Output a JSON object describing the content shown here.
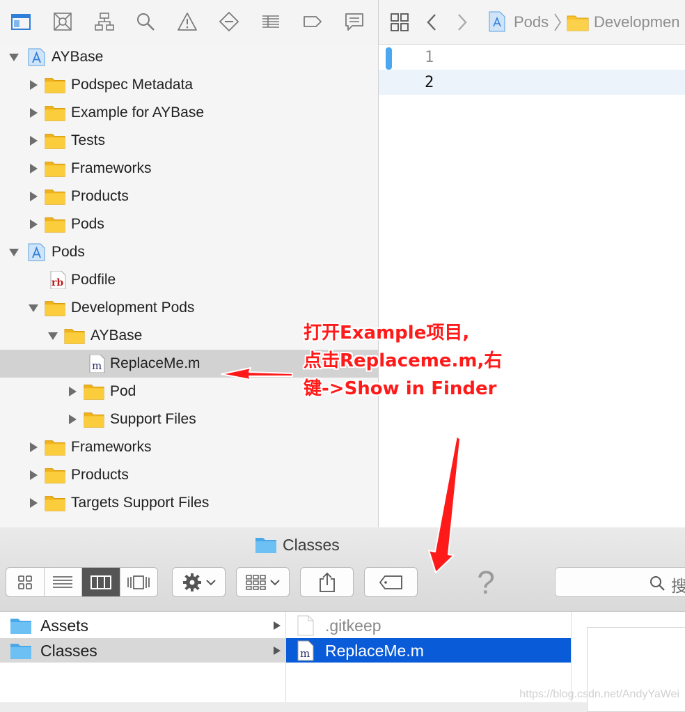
{
  "xcode": {
    "navigator_toolbar": {
      "icons": [
        "project-navigator-icon",
        "source-control-icon",
        "symbol-navigator-icon",
        "find-icon",
        "issue-icon",
        "test-icon",
        "debug-icon",
        "breakpoint-icon",
        "report-icon"
      ]
    },
    "jump_bar": {
      "items": [
        "Pods",
        "Developmen"
      ]
    },
    "tree": [
      {
        "label": "AYBase",
        "level": 0,
        "kind": "project",
        "expanded": true
      },
      {
        "label": "Podspec Metadata",
        "level": 1,
        "kind": "folder",
        "expanded": false
      },
      {
        "label": "Example for AYBase",
        "level": 1,
        "kind": "folder",
        "expanded": false
      },
      {
        "label": "Tests",
        "level": 1,
        "kind": "folder",
        "expanded": false
      },
      {
        "label": "Frameworks",
        "level": 1,
        "kind": "folder",
        "expanded": false
      },
      {
        "label": "Products",
        "level": 1,
        "kind": "folder",
        "expanded": false
      },
      {
        "label": "Pods",
        "level": 1,
        "kind": "folder",
        "expanded": false
      },
      {
        "label": "Pods",
        "level": 0,
        "kind": "project",
        "expanded": true
      },
      {
        "label": "Podfile",
        "level": 1,
        "kind": "ruby-file"
      },
      {
        "label": "Development Pods",
        "level": 1,
        "kind": "folder",
        "expanded": true
      },
      {
        "label": "AYBase",
        "level": 2,
        "kind": "folder",
        "expanded": true
      },
      {
        "label": "ReplaceMe.m",
        "level": 3,
        "kind": "m-file",
        "selected": true
      },
      {
        "label": "Pod",
        "level": 3,
        "kind": "folder",
        "expanded": false
      },
      {
        "label": "Support Files",
        "level": 3,
        "kind": "folder",
        "expanded": false
      },
      {
        "label": "Frameworks",
        "level": 1,
        "kind": "folder",
        "expanded": false
      },
      {
        "label": "Products",
        "level": 1,
        "kind": "folder",
        "expanded": false
      },
      {
        "label": "Targets Support Files",
        "level": 1,
        "kind": "folder",
        "expanded": false
      }
    ],
    "editor": {
      "line_numbers": [
        "1",
        "2"
      ],
      "current_line": 2
    }
  },
  "finder": {
    "title": "Classes",
    "search_placeholder": "搜",
    "help_glyph": "?",
    "column1": [
      {
        "label": "Assets",
        "selected": false
      },
      {
        "label": "Classes",
        "selected": true
      }
    ],
    "column2": [
      {
        "label": ".gitkeep",
        "kind": "plain-file",
        "selected": false
      },
      {
        "label": "ReplaceMe.m",
        "kind": "m-file",
        "selected": true
      }
    ],
    "watermark": "https://blog.csdn.net/AndyYaWei"
  },
  "annotation": {
    "lines": [
      "打开Example项目,",
      "点击Replaceme.m,右",
      "键->Show in Finder"
    ],
    "color": "#ff1a1a"
  },
  "colors": {
    "folder": "#f9c22e",
    "selection_blue": "#0a5bd8",
    "selection_gray": "#d2d2d2",
    "finder_folder": "#5ab4ec"
  }
}
